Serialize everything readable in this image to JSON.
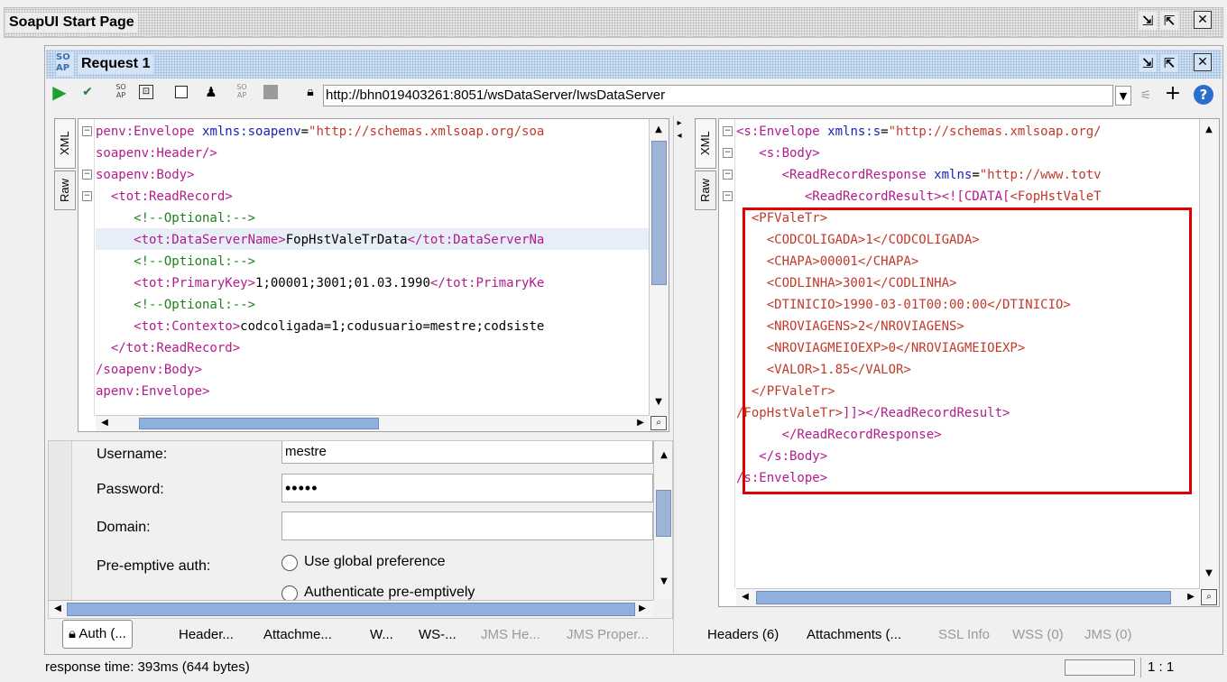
{
  "window": {
    "title": "SoapUI Start Page"
  },
  "request": {
    "title": "Request 1",
    "icon_text": "SO AP",
    "endpoint": "http://bhn019403261:8051/wsDataServer/IwsDataServer"
  },
  "request_editor": {
    "tabs": {
      "xml": "XML",
      "raw": "Raw"
    },
    "lines": [
      "penv:Envelope xmlns:soapenv=\"http://schemas.xmlsoap.org/soa",
      "soapenv:Header/>",
      "soapenv:Body>",
      "  <tot:ReadRecord>",
      "     <!--Optional:-->",
      "     <tot:DataServerName>FopHstValeTrData</tot:DataServerNa",
      "     <!--Optional:-->",
      "     <tot:PrimaryKey>1;00001;3001;01.03.1990</tot:PrimaryKe",
      "     <!--Optional:-->",
      "     <tot:Contexto>codcoligada=1;codusuario=mestre;codsiste",
      "  </tot:ReadRecord>",
      "/soapenv:Body>",
      "apenv:Envelope>"
    ]
  },
  "response_editor": {
    "tabs": {
      "xml": "XML",
      "raw": "Raw"
    },
    "lines": [
      "<s:Envelope xmlns:s=\"http://schemas.xmlsoap.org/",
      "   <s:Body>",
      "      <ReadRecordResponse xmlns=\"http://www.totv",
      "         <ReadRecordResult><![CDATA[<FopHstValeT",
      "  <PFValeTr>",
      "    <CODCOLIGADA>1</CODCOLIGADA>",
      "    <CHAPA>00001</CHAPA>",
      "    <CODLINHA>3001</CODLINHA>",
      "    <DTINICIO>1990-03-01T00:00:00</DTINICIO>",
      "    <NROVIAGENS>2</NROVIAGENS>",
      "    <NROVIAGMEIOEXP>0</NROVIAGMEIOEXP>",
      "    <VALOR>1.85</VALOR>",
      "  </PFValeTr>",
      "/FopHstValeTr>]]></ReadRecordResult>",
      "         </ReadRecordResponse>",
      "   </s:Body>",
      "/s:Envelope>"
    ],
    "highlight_color": "#e00000"
  },
  "auth": {
    "username_label": "Username:",
    "username_value": "mestre",
    "password_label": "Password:",
    "password_value": "•••••",
    "domain_label": "Domain:",
    "domain_value": "",
    "preemptive_label": "Pre-emptive auth:",
    "option_global": "Use global preference",
    "option_authenticate": "Authenticate pre-emptively"
  },
  "request_tabs": [
    "Auth (...",
    "Header...",
    "Attachme...",
    "W...",
    "WS-...",
    "JMS He...",
    "JMS Proper..."
  ],
  "response_tabs": [
    "Headers (6)",
    "Attachments (...",
    "SSL Info",
    "WSS (0)",
    "JMS (0)"
  ],
  "status": {
    "response_time": "response time: 393ms (644 bytes)",
    "position": "1 : 1"
  }
}
